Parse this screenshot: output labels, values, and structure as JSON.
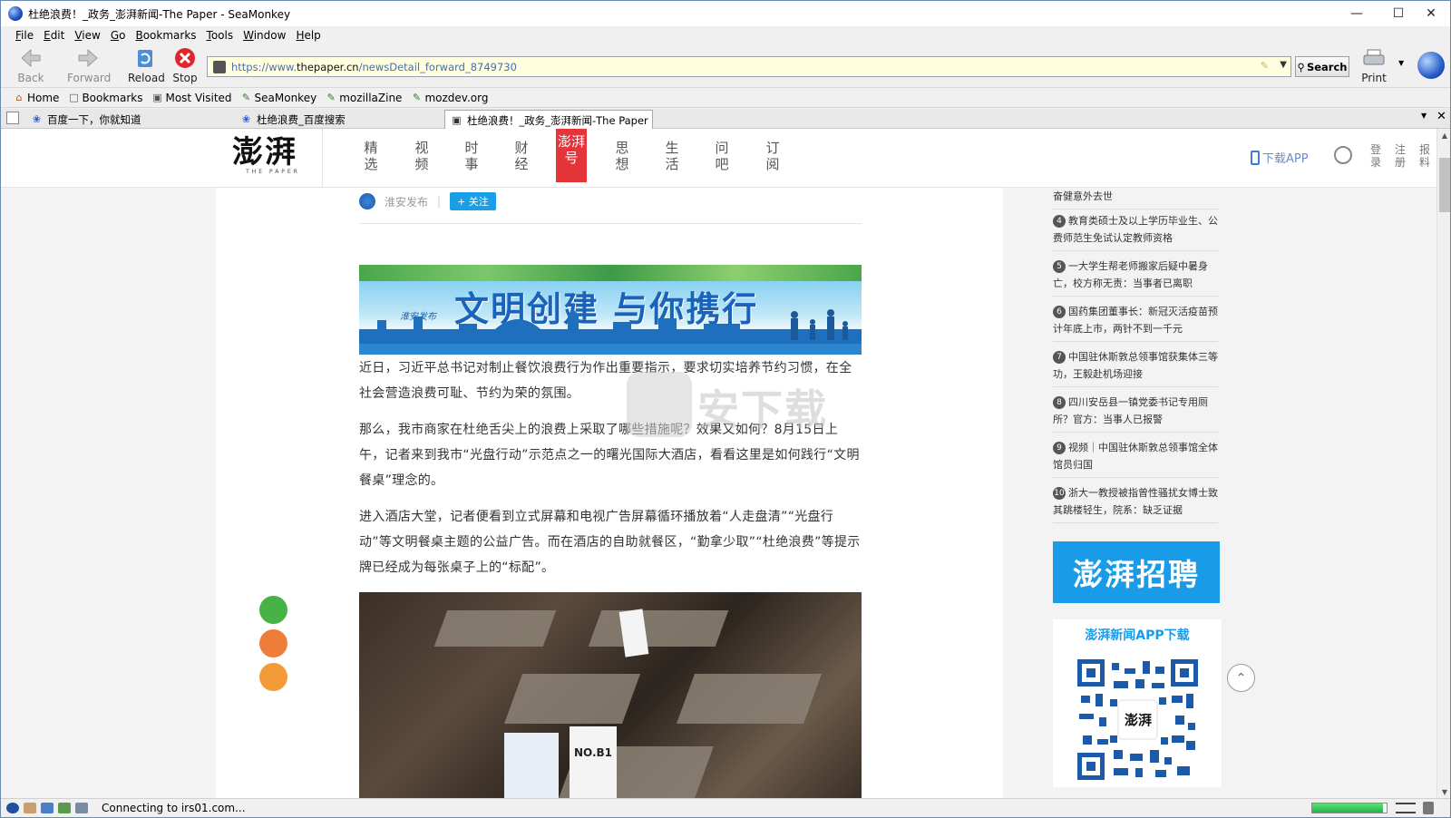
{
  "window": {
    "title": "杜绝浪费！_政务_澎湃新闻-The Paper - SeaMonkey"
  },
  "menu": [
    "File",
    "Edit",
    "View",
    "Go",
    "Bookmarks",
    "Tools",
    "Window",
    "Help"
  ],
  "toolbar": {
    "back": "Back",
    "forward": "Forward",
    "reload": "Reload",
    "stop": "Stop",
    "search": "Search",
    "print": "Print"
  },
  "url": {
    "prefix": "https://www.",
    "domain": "thepaper.cn",
    "path": "/newsDetail_forward_8749730"
  },
  "bookmarks": [
    "Home",
    "Bookmarks",
    "Most Visited",
    "SeaMonkey",
    "mozillaZine",
    "mozdev.org"
  ],
  "tabs": [
    {
      "label": "百度一下，你就知道"
    },
    {
      "label": "杜绝浪费_百度搜索"
    },
    {
      "label": "杜绝浪费！_政务_澎湃新闻-The Paper"
    }
  ],
  "site": {
    "logo": "澎湃",
    "logo_sub": "THE PAPER",
    "nav": [
      "精选",
      "视频",
      "时事",
      "财经",
      "澎湃号",
      "思想",
      "生活",
      "问吧",
      "订阅"
    ],
    "download_app": "下载APP",
    "login": "登录",
    "register": "注册",
    "report": "报料"
  },
  "article": {
    "author": "淮安发布",
    "follow": "+ 关注",
    "banner_title": "文明创建  与你携行",
    "banner_sub": "淮安发布",
    "paragraphs": [
      "近日，习近平总书记对制止餐饮浪费行为作出重要指示，要求切实培养节约习惯，在全社会营造浪费可耻、节约为荣的氛围。",
      "那么，我市商家在杜绝舌尖上的浪费上采取了哪些措施呢？效果又如何？8月15日上午，记者来到我市“光盘行动”示范点之一的曙光国际大酒店，看看这里是如何践行“文明餐桌”理念的。",
      "进入酒店大堂，记者便看到立式屏幕和电视广告屏幕循环播放着“人走盘清”“光盘行动”等文明餐桌主题的公益广告。而在酒店的自助就餐区，“勤拿少取”“杜绝浪费”等提示牌已经成为每张桌子上的“标配”。"
    ],
    "photo_card": "NO.B1"
  },
  "watermark": "安下载",
  "sidebar": {
    "items": [
      {
        "num": "",
        "text": "奋健意外去世"
      },
      {
        "num": "4",
        "text": "教育类硕士及以上学历毕业生、公费师范生免试认定教师资格"
      },
      {
        "num": "5",
        "text": "一大学生帮老师搬家后疑中暑身亡，校方称无责：当事者已离职"
      },
      {
        "num": "6",
        "text": "国药集团董事长：新冠灭活疫苗预计年底上市，两针不到一千元"
      },
      {
        "num": "7",
        "text": "中国驻休斯敦总领事馆获集体三等功，王毅赴机场迎接"
      },
      {
        "num": "8",
        "text": "四川安岳县一镇党委书记专用厕所？官方：当事人已报警"
      },
      {
        "num": "9",
        "text": "视频｜中国驻休斯敦总领事馆全体馆员归国"
      },
      {
        "num": "10",
        "text": "浙大一教授被指曾性骚扰女博士致其跳楼轻生，院系：缺乏证据"
      }
    ],
    "recruit": "澎湃招聘",
    "app_title": "澎湃新闻APP下载",
    "qr_center": "澎湃"
  },
  "status": {
    "text": "Connecting to irs01.com...",
    "progress": 0.95
  }
}
